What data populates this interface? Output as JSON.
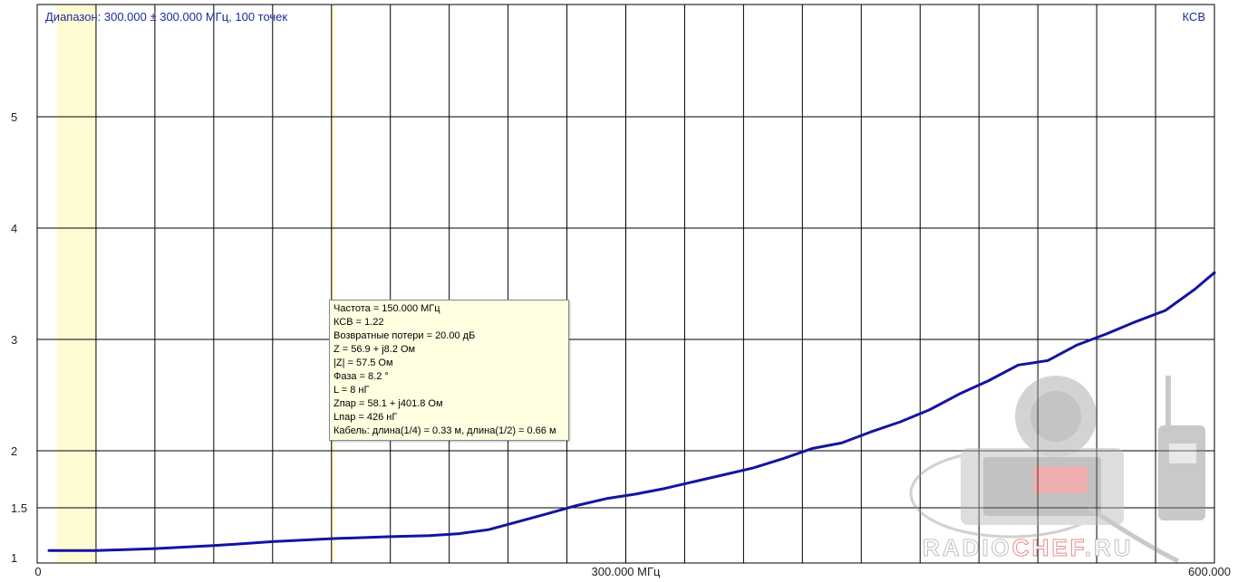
{
  "header": {
    "range_text": "Диапазон: 300.000 ± 300.000 МГц, 100 точек",
    "quantity_label": "КСВ"
  },
  "colors": {
    "curve": "#1414a0",
    "grid": "#000000",
    "highlight_band": "#fffbd2",
    "text": "#1e2a9a"
  },
  "chart_data": {
    "type": "line",
    "title": "",
    "xlabel": "",
    "ylabel": "КСВ",
    "x_unit": "МГц",
    "xlim": [
      0,
      600
    ],
    "ylim": [
      1,
      5.8
    ],
    "grid": true,
    "x_ticks": [
      {
        "value": 0,
        "label": "0"
      },
      {
        "value": 300,
        "label": "300.000 МГц"
      },
      {
        "value": 600,
        "label": "600.000"
      }
    ],
    "y_ticks": [
      {
        "value": 1,
        "label": "1"
      },
      {
        "value": 1.5,
        "label": "1.5"
      },
      {
        "value": 2,
        "label": "2"
      },
      {
        "value": 3,
        "label": "3"
      },
      {
        "value": 4,
        "label": "4"
      },
      {
        "value": 5,
        "label": "5"
      }
    ],
    "series": [
      {
        "x": [
          6,
          30,
          60,
          90,
          120,
          150,
          180,
          200,
          215,
          230,
          245,
          260,
          275,
          290,
          305,
          320,
          335,
          350,
          365,
          380,
          395,
          410,
          425,
          440,
          455,
          470,
          485,
          500,
          515,
          530,
          545,
          560,
          575,
          590,
          600
        ],
        "y": [
          1.07,
          1.07,
          1.09,
          1.12,
          1.16,
          1.19,
          1.21,
          1.22,
          1.24,
          1.28,
          1.36,
          1.44,
          1.52,
          1.58,
          1.62,
          1.67,
          1.73,
          1.79,
          1.85,
          1.93,
          2.02,
          2.07,
          2.17,
          2.26,
          2.37,
          2.51,
          2.63,
          2.77,
          2.81,
          2.95,
          3.05,
          3.16,
          3.26,
          3.45,
          3.6
        ]
      }
    ],
    "marker": {
      "x": 150,
      "lines": [
        "Частота = 150.000 МГц",
        "КСВ = 1.22",
        "Возвратные потери = 20.00 дБ",
        "Z = 56.9 + j8.2 Ом",
        "|Z| = 57.5 Ом",
        "Фаза = 8.2 °",
        "L = 8 нГ",
        "Zпар = 58.1 + j401.8 Ом",
        "Lпар = 426 нГ",
        "Кабель: длина(1/4) = 0.33 м, длина(1/2) = 0.66 м"
      ]
    },
    "highlight_bands": [
      [
        10,
        30
      ],
      [
        150,
        152
      ]
    ]
  },
  "watermark": {
    "text_a": "RADIO",
    "text_b": "CHEF",
    "text_c": ".RU"
  }
}
